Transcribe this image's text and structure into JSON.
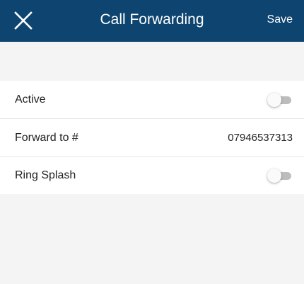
{
  "header": {
    "title": "Call Forwarding",
    "save_label": "Save",
    "close_icon": "close-icon",
    "background_color": "#0d4470"
  },
  "settings": [
    {
      "label": "Active",
      "type": "toggle",
      "checked": false
    },
    {
      "label": "Forward to #",
      "type": "value",
      "value": "07946537313"
    },
    {
      "label": "Ring Splash",
      "type": "toggle",
      "checked": false
    }
  ]
}
